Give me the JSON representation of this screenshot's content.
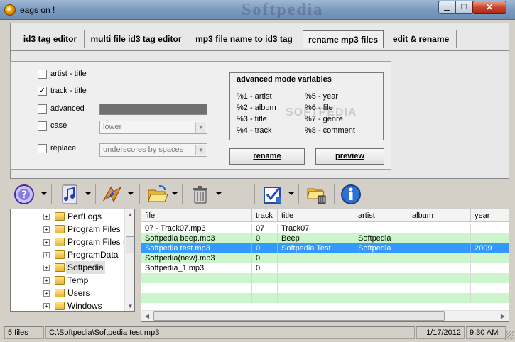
{
  "window": {
    "title": "eags on !",
    "watermark": "Softpedia"
  },
  "tabs": [
    {
      "label": "id3 tag editor"
    },
    {
      "label": "multi file id3 tag editor"
    },
    {
      "label": "mp3 file name to id3 tag"
    },
    {
      "label": "rename mp3 files",
      "active": true
    },
    {
      "label": "edit & rename"
    }
  ],
  "options": {
    "artist_title": {
      "label": "artist - title",
      "checked": false
    },
    "track_title": {
      "label": "track - title",
      "checked": true,
      "mark": "✓"
    },
    "advanced": {
      "label": "advanced",
      "checked": false
    },
    "case": {
      "label": "case",
      "checked": false,
      "value": "lower"
    },
    "replace": {
      "label": "replace",
      "checked": false,
      "value": "underscores by spaces"
    }
  },
  "variables": {
    "header": "advanced mode variables",
    "left": [
      "%1 - artist",
      "%2 - album",
      "%3 - title",
      "%4 - track"
    ],
    "right": [
      "%5 - year",
      "%6 - file",
      "%7 - genre",
      "%8 - comment"
    ],
    "watermark": "SOFTPEDIA"
  },
  "buttons": {
    "rename": "rename",
    "preview": "preview"
  },
  "toolbar": [
    {
      "icon": "help-icon"
    },
    {
      "icon": "music-note-icon"
    },
    {
      "icon": "lightning-icon"
    },
    {
      "icon": "open-folder-icon"
    },
    {
      "icon": "trash-icon"
    },
    {
      "icon": "checklist-icon"
    },
    {
      "icon": "folder-delete-icon"
    },
    {
      "icon": "info-icon"
    }
  ],
  "tree": [
    {
      "name": "PerfLogs"
    },
    {
      "name": "Program Files"
    },
    {
      "name": "Program Files ("
    },
    {
      "name": "ProgramData"
    },
    {
      "name": "Softpedia",
      "selected": true
    },
    {
      "name": "Temp"
    },
    {
      "name": "Users"
    },
    {
      "name": "Windows"
    }
  ],
  "filelist": {
    "columns": [
      "file",
      "track",
      "title",
      "artist",
      "album",
      "year"
    ],
    "rows": [
      [
        "07 - Track07.mp3",
        "07",
        "Track07",
        "",
        "",
        ""
      ],
      [
        "Softpedia beep.mp3",
        "0",
        "Beep",
        "Softpedia",
        "",
        ""
      ],
      [
        "Softpedia test.mp3",
        "0",
        "Softpedia Test",
        "Softpedia",
        "",
        "2009"
      ],
      [
        "Softpedia(new).mp3",
        "0",
        "",
        "",
        "",
        ""
      ],
      [
        "Softpedia_1.mp3",
        "0",
        "",
        "",
        "",
        ""
      ],
      [
        "",
        "",
        "",
        "",
        "",
        ""
      ],
      [
        "",
        "",
        "",
        "",
        "",
        ""
      ],
      [
        "",
        "",
        "",
        "",
        "",
        ""
      ]
    ],
    "selected_row": 2
  },
  "status": {
    "count": "5 files",
    "path": "C:\\Softpedia\\Softpedia test.mp3",
    "date": "1/17/2012",
    "time": "9:30 AM"
  }
}
